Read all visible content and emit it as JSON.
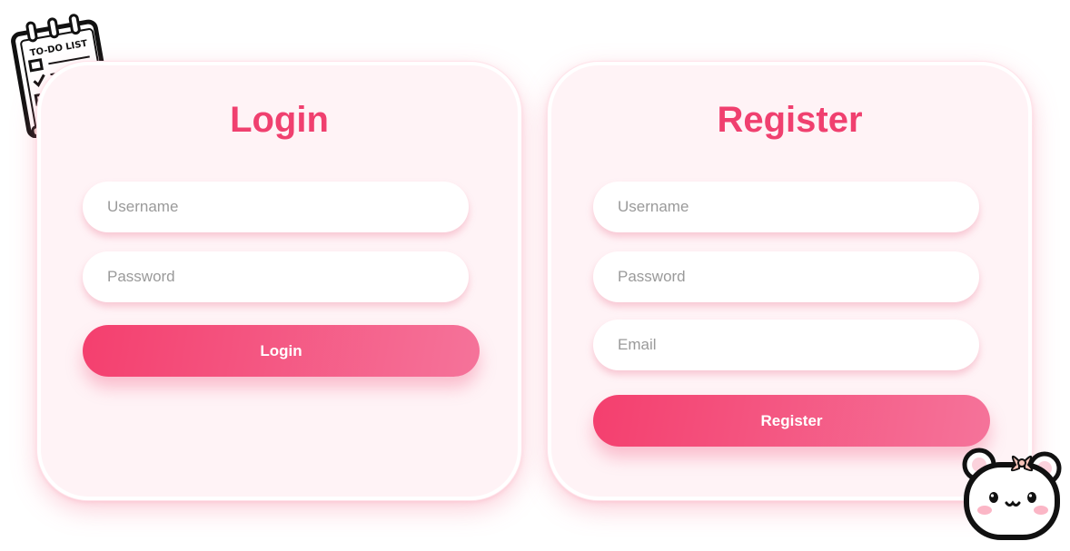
{
  "login": {
    "title": "Login",
    "username_placeholder": "Username",
    "password_placeholder": "Password",
    "button_label": "Login"
  },
  "register": {
    "title": "Register",
    "username_placeholder": "Username",
    "password_placeholder": "Password",
    "email_placeholder": "Email",
    "button_label": "Register"
  },
  "decor": {
    "todo_icon": "todo-list-sticker",
    "todo_text": "TO-DO LIST",
    "mascot_icon": "bear-mascot-sticker"
  },
  "colors": {
    "accent": "#f0406f",
    "card_bg": "#fff3f6",
    "button_gradient_start": "#f43f6e",
    "button_gradient_end": "#f5739a"
  }
}
